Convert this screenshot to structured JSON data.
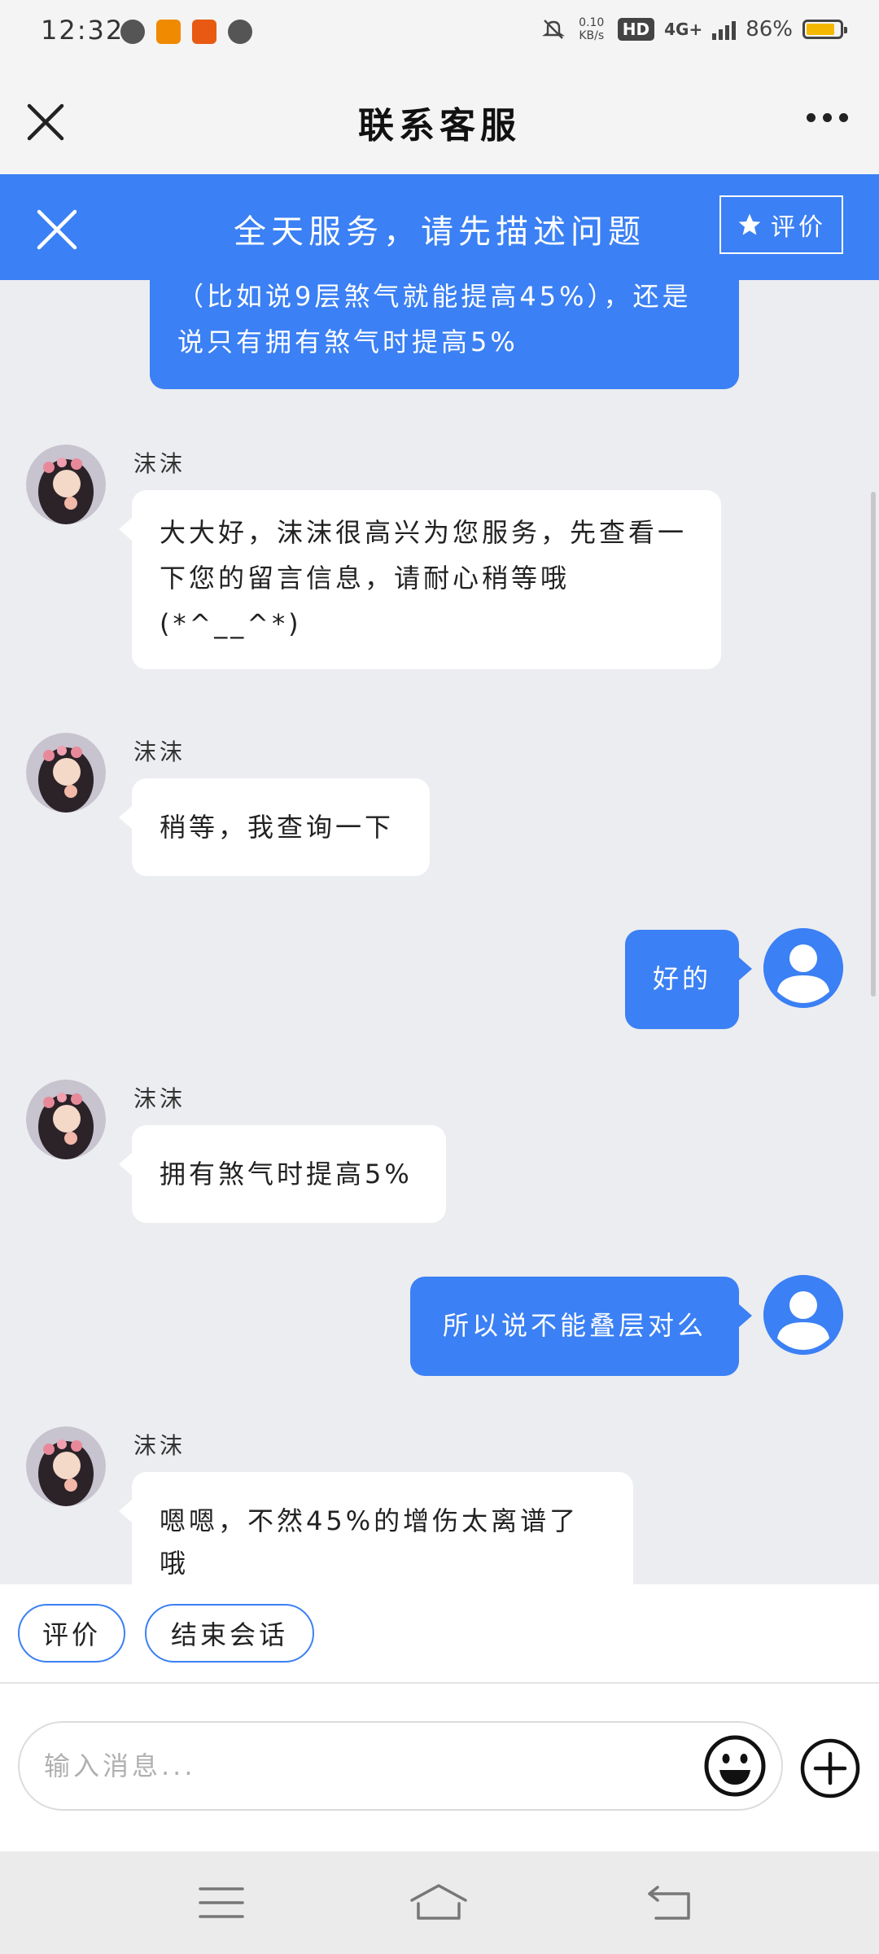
{
  "status_bar": {
    "time": "12:32",
    "net_speed": "0.10 KB/s",
    "hd": "HD",
    "network": "4G+",
    "battery_percent": "86%",
    "battery_level": 0.86
  },
  "header": {
    "title": "联系客服"
  },
  "banner": {
    "text": "全天服务，请先描述问题",
    "rate_label": "评价"
  },
  "messages": [
    {
      "side": "out",
      "text": "（比如说9层煞气就能提高45%），还是说只有拥有煞气时提高5%"
    },
    {
      "side": "in",
      "name": "沫沫",
      "text": "大大好，沫沫很高兴为您服务，先查看一下您的留言信息，请耐心稍等哦(*^__^*)"
    },
    {
      "side": "in",
      "name": "沫沫",
      "text": "稍等，我查询一下"
    },
    {
      "side": "out",
      "text": "好的"
    },
    {
      "side": "in",
      "name": "沫沫",
      "text": "拥有煞气时提高5%"
    },
    {
      "side": "out",
      "text": "所以说不能叠层对么"
    },
    {
      "side": "in",
      "name": "沫沫",
      "text": "嗯嗯，不然45%的增伤太离谱了哦"
    }
  ],
  "actions": {
    "rate": "评价",
    "end": "结束会话"
  },
  "input": {
    "placeholder": "输入消息..."
  },
  "colors": {
    "accent": "#3b80f4",
    "background": "#ecedf0"
  }
}
